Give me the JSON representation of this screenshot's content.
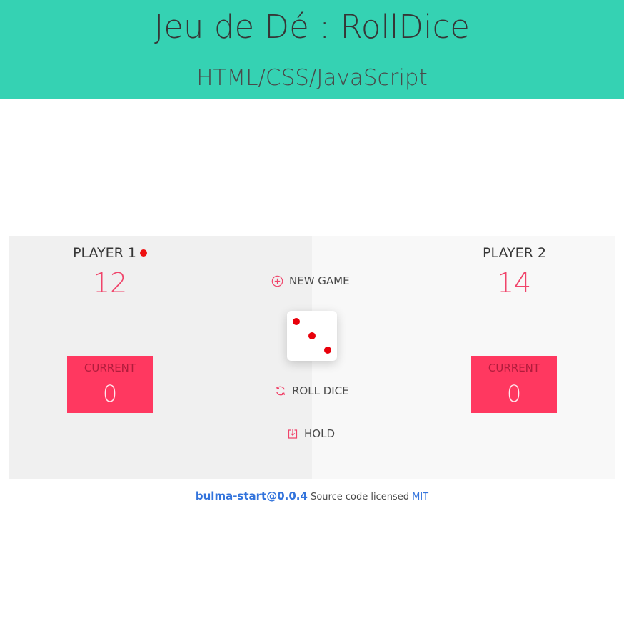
{
  "header": {
    "title": "Jeu de Dé : RollDice",
    "subtitle": "HTML/CSS/JavaScript",
    "background_color": "#35d2b3"
  },
  "players": [
    {
      "name": "PLAYER 1",
      "score": "12",
      "current_label": "CURRENT",
      "current_value": "0",
      "active": true
    },
    {
      "name": "PLAYER 2",
      "score": "14",
      "current_label": "CURRENT",
      "current_value": "0",
      "active": false
    }
  ],
  "controls": {
    "new_game_label": "NEW GAME",
    "roll_dice_label": "ROLL DICE",
    "hold_label": "HOLD"
  },
  "dice": {
    "face_value": 3
  },
  "footer": {
    "brand": "bulma-start@0.0.4",
    "text": "Source code licensed",
    "license_link": "MIT"
  },
  "colors": {
    "accent": "#ff3860",
    "score_text": "#f0446a",
    "active_indicator": "#ee1111",
    "link": "#3273dc"
  },
  "icons": {
    "new_game": "plus-circle-icon",
    "roll_dice": "refresh-icon",
    "hold": "download-icon"
  }
}
